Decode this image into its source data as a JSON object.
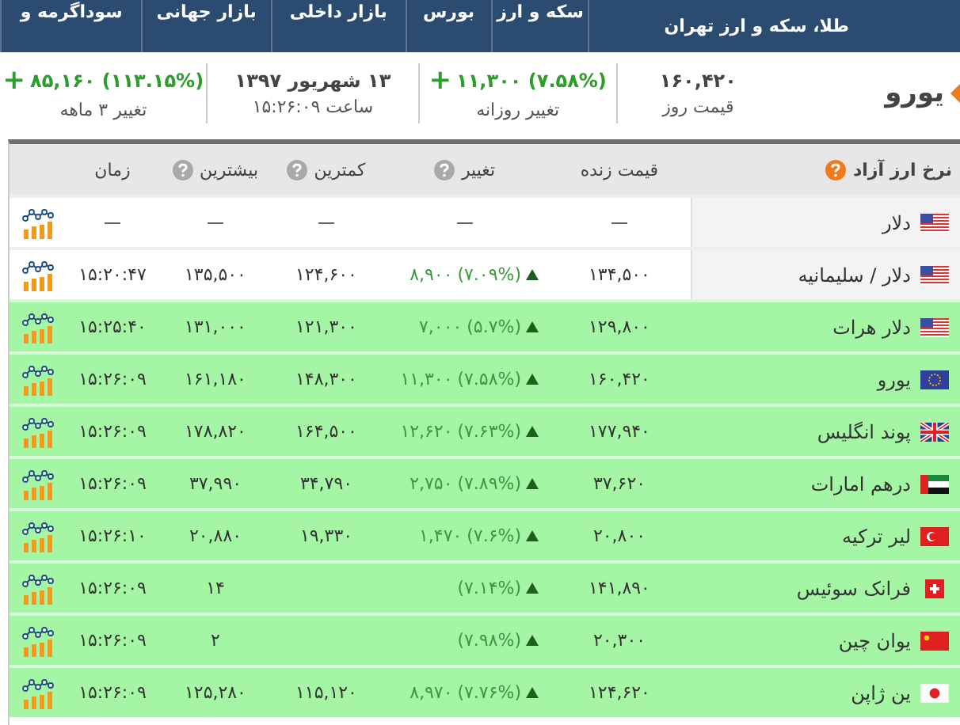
{
  "nav": {
    "brand": "طلا، سکه و ارز تهران",
    "tabs": [
      {
        "label": "سکه و ارز"
      },
      {
        "label": "بورس"
      },
      {
        "label": "بازار داخلی"
      },
      {
        "label": "بازار جهانی"
      },
      {
        "label": "سوداگرمه و"
      }
    ]
  },
  "summary": {
    "name": "یورو",
    "stats": [
      {
        "value": "۱۶۰,۴۲۰",
        "label": "قیمت روز"
      },
      {
        "sign": "+",
        "value": "۱۱,۳۰۰ (۷.۵۸%)",
        "label": "تغییر روزانه"
      },
      {
        "value": "۱۳ شهریور ۱۳۹۷",
        "label": "ساعت ۱۵:۲۶:۰۹"
      },
      {
        "sign": "+",
        "value": "۸۵,۱۶۰ (۱۱۳.۱۵%)",
        "label": "تغییر ۳ ماهه"
      }
    ]
  },
  "table": {
    "columns": [
      {
        "label": "نرخ ارز آزاد",
        "help": true
      },
      {
        "label": "قیمت زنده",
        "help": false
      },
      {
        "label": "تغییر",
        "help": true
      },
      {
        "label": "کمترین",
        "help": true
      },
      {
        "label": "بیشترین",
        "help": true
      },
      {
        "label": "زمان",
        "help": false
      }
    ],
    "rows": [
      {
        "name": "دلار",
        "kind": "us",
        "highlighted": false,
        "price": "—",
        "change": "—",
        "min": "—",
        "max": "—",
        "time": "—"
      },
      {
        "name": "دلار / سلیمانیه",
        "kind": "us",
        "highlighted": false,
        "price": "۱۳۴,۵۰۰",
        "change": "۸,۹۰۰",
        "percent": "(۷.۰۹%)",
        "up": true,
        "min": "۱۲۴,۶۰۰",
        "max": "۱۳۵,۵۰۰",
        "time": "۱۵:۲۰:۴۷"
      },
      {
        "name": "دلار هرات",
        "kind": "us",
        "highlighted": true,
        "price": "۱۲۹,۸۰۰",
        "change": "۷,۰۰۰",
        "percent": "(۵.۷%)",
        "up": true,
        "min": "۱۲۱,۳۰۰",
        "max": "۱۳۱,۰۰۰",
        "time": "۱۵:۲۵:۴۰"
      },
      {
        "name": "یورو",
        "kind": "eu",
        "highlighted": true,
        "price": "۱۶۰,۴۲۰",
        "change": "۱۱,۳۰۰",
        "percent": "(۷.۵۸%)",
        "up": true,
        "min": "۱۴۸,۳۰۰",
        "max": "۱۶۱,۱۸۰",
        "time": "۱۵:۲۶:۰۹"
      },
      {
        "name": "پوند انگلیس",
        "kind": "gb",
        "highlighted": true,
        "price": "۱۷۷,۹۴۰",
        "change": "۱۲,۶۲۰",
        "percent": "(۷.۶۳%)",
        "up": true,
        "min": "۱۶۴,۵۰۰",
        "max": "۱۷۸,۸۲۰",
        "time": "۱۵:۲۶:۰۹"
      },
      {
        "name": "درهم امارات",
        "kind": "ae",
        "highlighted": true,
        "price": "۳۷,۶۲۰",
        "change": "۲,۷۵۰",
        "percent": "(۷.۸۹%)",
        "up": true,
        "min": "۳۴,۷۹۰",
        "max": "۳۷,۹۹۰",
        "time": "۱۵:۲۶:۰۹"
      },
      {
        "name": "لیر ترکیه",
        "kind": "tr",
        "highlighted": true,
        "price": "۲۰,۸۰۰",
        "change": "۱,۴۷۰",
        "percent": "(۷.۶%)",
        "up": true,
        "min": "۱۹,۳۳۰",
        "max": "۲۰,۸۸۰",
        "time": "۱۵:۲۶:۱۰"
      },
      {
        "name": "فرانک سوئیس",
        "kind": "ch",
        "highlighted": true,
        "price": "۱۴۱,۸۹۰",
        "percent": "(۷.۱۴%)",
        "up": true,
        "max": "۱۴",
        "time": "۱۵:۲۶:۰۹"
      },
      {
        "name": "یوان چین",
        "kind": "cn",
        "highlighted": true,
        "price": "۲۰,۳۰۰",
        "percent": "(۷.۹۸%)",
        "up": true,
        "max": "۲",
        "time": "۱۵:۲۶:۰۹"
      },
      {
        "name": "ین ژاپن",
        "kind": "jp",
        "highlighted": true,
        "price": "۱۲۴,۶۲۰",
        "change": "۸,۹۷۰",
        "percent": "(۷.۷۶%)",
        "up": true,
        "min": "۱۱۵,۱۲۰",
        "max": "۱۲۵,۲۸۰",
        "time": "۱۵:۲۶:۰۹"
      }
    ]
  }
}
